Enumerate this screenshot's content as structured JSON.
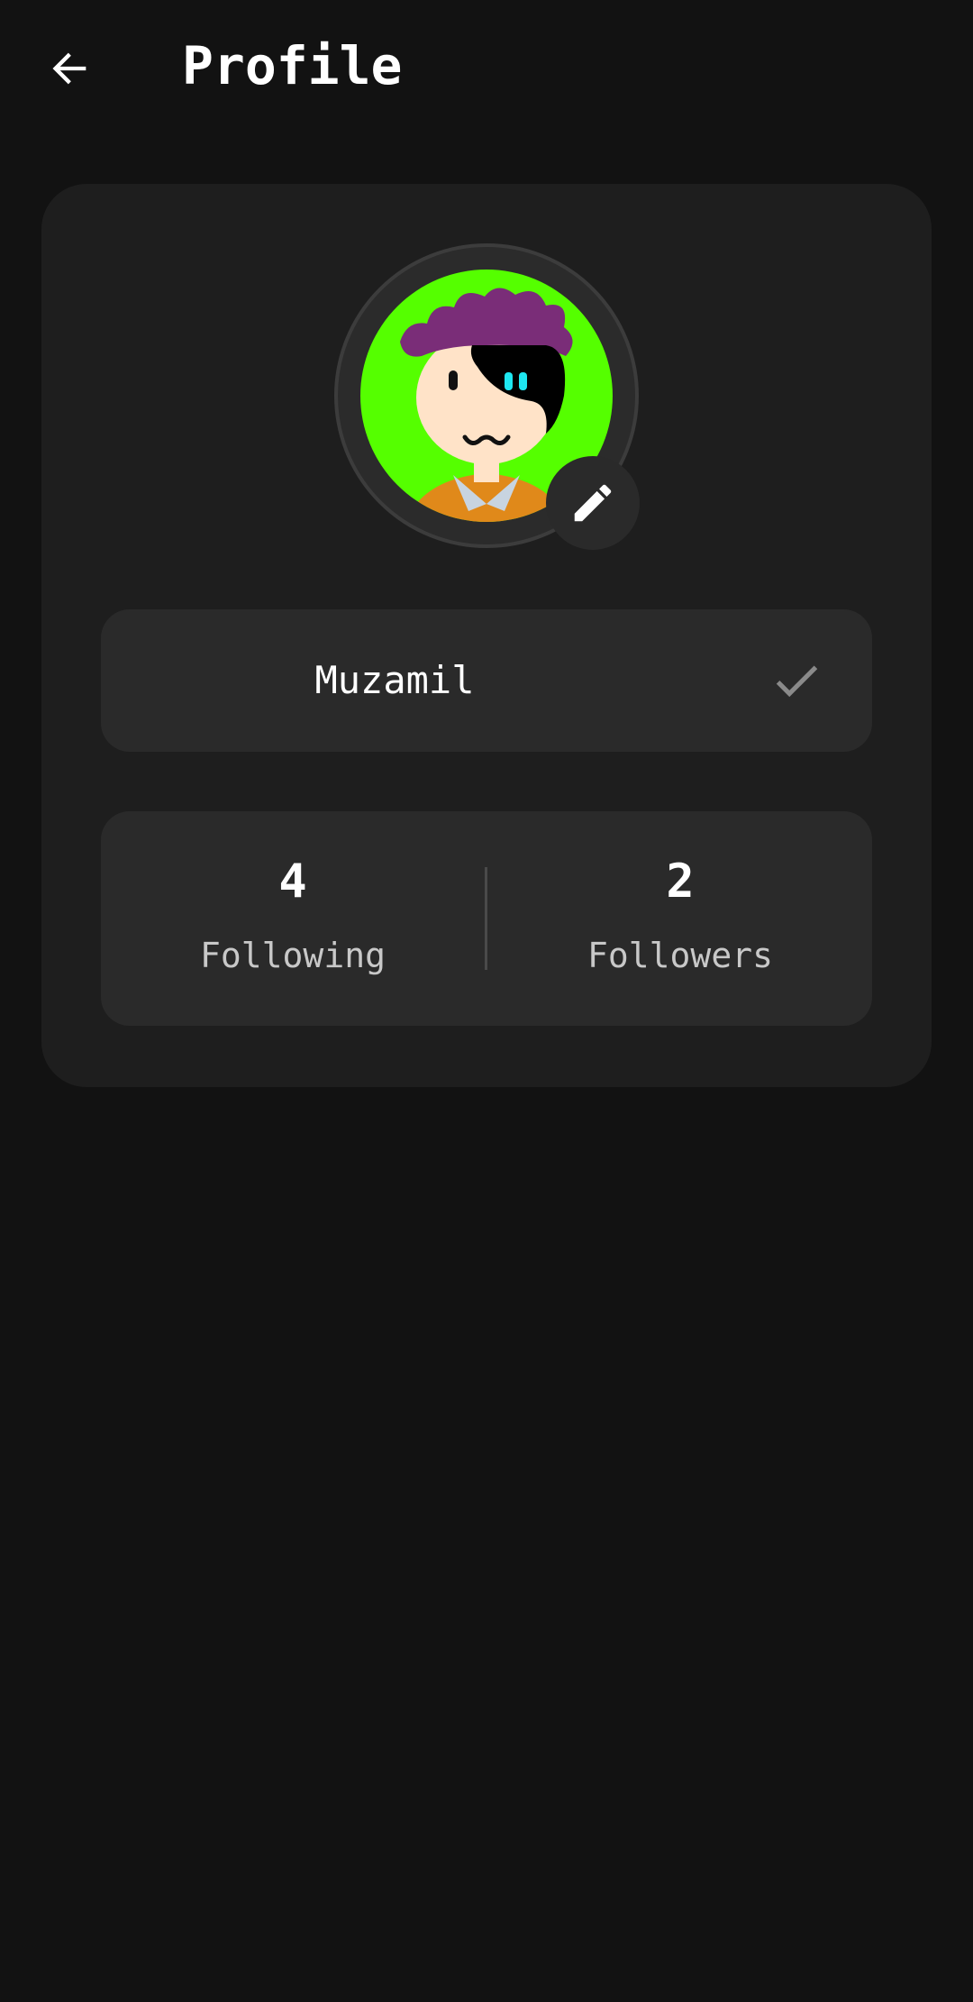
{
  "header": {
    "title": "Profile",
    "back_icon": "arrow-left-icon"
  },
  "profile": {
    "avatar_description": "cartoon-avatar",
    "edit_icon": "pencil-icon",
    "name": "Muzamil",
    "confirm_icon": "checkmark-icon"
  },
  "stats": {
    "following": {
      "value": "4",
      "label": "Following"
    },
    "followers": {
      "value": "2",
      "label": "Followers"
    }
  },
  "colors": {
    "background": "#121212",
    "card": "#1e1e1e",
    "surface": "#2a2a2a",
    "avatar_background": "#55ff00",
    "text_primary": "#ffffff",
    "text_secondary": "#c8c8c8"
  }
}
